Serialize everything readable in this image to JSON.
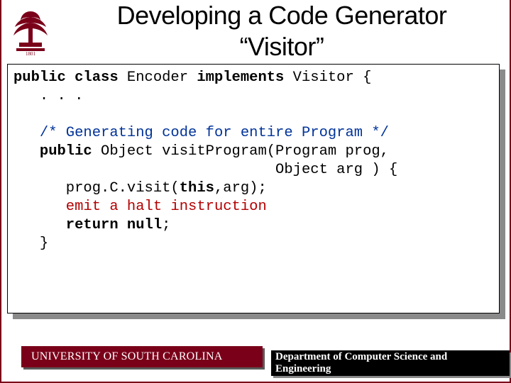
{
  "title_line1": "Developing a Code Generator",
  "title_line2": "“Visitor”",
  "code": {
    "l1a": "public class",
    "l1b": " Encoder ",
    "l1c": "implements",
    "l1d": " Visitor {",
    "l2": "   . . .",
    "l3": "",
    "l4": "   /* Generating code for entire Program */",
    "l5a": "   public",
    "l5b": " Object visitProgram(Program prog,",
    "l6": "                              Object arg ) {",
    "l7a": "      prog.C.visit(",
    "l7b": "this",
    "l7c": ",arg);",
    "l8": "      emit a halt instruction",
    "l9a": "      return null",
    "l9b": ";",
    "l10": "   }"
  },
  "footer": {
    "left": "UNIVERSITY OF SOUTH CAROLINA",
    "right": "Department of Computer Science and Engineering"
  }
}
